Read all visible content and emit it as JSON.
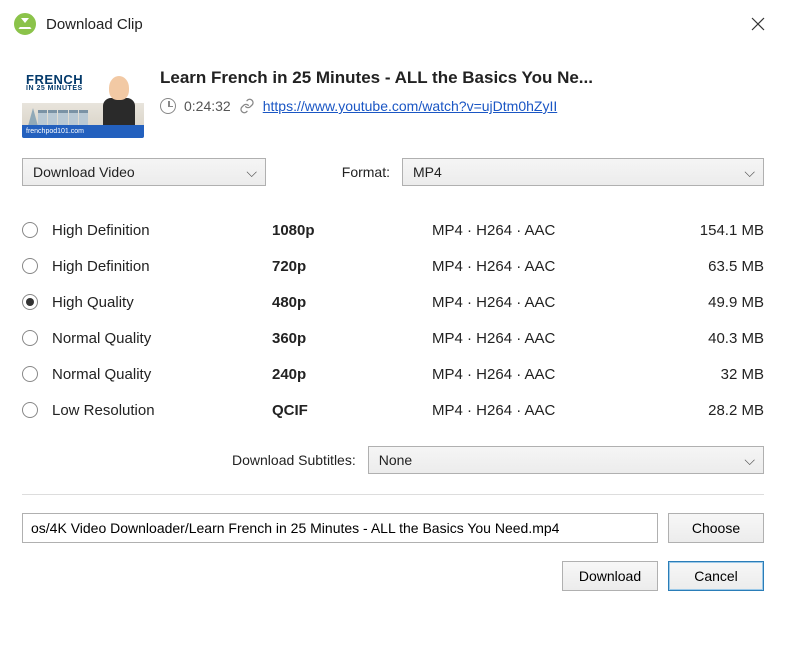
{
  "window": {
    "title": "Download Clip"
  },
  "video": {
    "thumb_text": "FRENCH",
    "thumb_sub": "IN 25 MINUTES",
    "thumb_bar": "frenchpod101.com",
    "title": "Learn French in 25 Minutes - ALL the Basics You Ne...",
    "duration": "0:24:32",
    "url": "https://www.youtube.com/watch?v=ujDtm0hZyII"
  },
  "action_select": "Download Video",
  "format_label": "Format:",
  "format_select": "MP4",
  "qualities": [
    {
      "label": "High Definition",
      "res": "1080p",
      "codec": "MP4 · H264 · AAC",
      "size": "154.1 MB",
      "checked": false
    },
    {
      "label": "High Definition",
      "res": "720p",
      "codec": "MP4 · H264 · AAC",
      "size": "63.5 MB",
      "checked": false
    },
    {
      "label": "High Quality",
      "res": "480p",
      "codec": "MP4 · H264 · AAC",
      "size": "49.9 MB",
      "checked": true
    },
    {
      "label": "Normal Quality",
      "res": "360p",
      "codec": "MP4 · H264 · AAC",
      "size": "40.3 MB",
      "checked": false
    },
    {
      "label": "Normal Quality",
      "res": "240p",
      "codec": "MP4 · H264 · AAC",
      "size": "32 MB",
      "checked": false
    },
    {
      "label": "Low Resolution",
      "res": "QCIF",
      "codec": "MP4 · H264 · AAC",
      "size": "28.2 MB",
      "checked": false
    }
  ],
  "subtitles_label": "Download Subtitles:",
  "subtitles_select": "None",
  "path": "os/4K Video Downloader/Learn French in 25 Minutes - ALL the Basics You Need.mp4",
  "buttons": {
    "choose": "Choose",
    "download": "Download",
    "cancel": "Cancel"
  }
}
